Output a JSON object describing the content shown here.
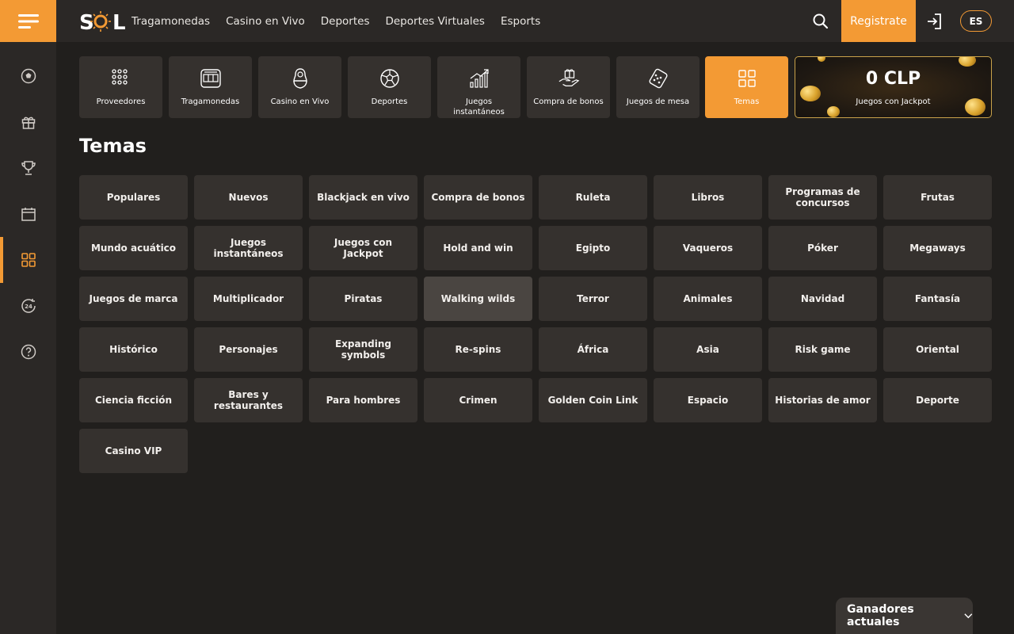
{
  "header": {
    "logo_text": "SOL",
    "nav": [
      "Tragamonedas",
      "Casino en Vivo",
      "Deportes",
      "Deportes Virtuales",
      "Esports"
    ],
    "register_label": "Registrate",
    "language": "ES",
    "accent_color": "#f39a34"
  },
  "sidebar": {
    "items": [
      "soccer-ball-icon",
      "gift-icon",
      "trophy-icon",
      "calendar-icon",
      "grid-icon",
      "support-24-icon",
      "help-icon"
    ],
    "active_index": 4
  },
  "categories": [
    {
      "label": "Proveedores",
      "icon": "dots-grid-icon"
    },
    {
      "label": "Tragamonedas",
      "icon": "slot-machine-icon"
    },
    {
      "label": "Casino en Vivo",
      "icon": "dealer-icon"
    },
    {
      "label": "Deportes",
      "icon": "soccer-ball-icon"
    },
    {
      "label": "Juegos instantáneos",
      "icon": "chart-up-icon"
    },
    {
      "label": "Compra de bonos",
      "icon": "hand-gift-icon"
    },
    {
      "label": "Juegos de mesa",
      "icon": "dice-icon"
    },
    {
      "label": "Temas",
      "icon": "grid-icon",
      "active": true
    }
  ],
  "jackpot": {
    "amount": "0 CLP",
    "label": "Juegos con Jackpot"
  },
  "page_title": "Temas",
  "themes": [
    "Populares",
    "Nuevos",
    "Blackjack en vivo",
    "Compra de bonos",
    "Ruleta",
    "Libros",
    "Programas de concursos",
    "Frutas",
    "Mundo acuático",
    "Juegos instantáneos",
    "Juegos con Jackpot",
    "Hold and win",
    "Egipto",
    "Vaqueros",
    "Póker",
    "Megaways",
    "Juegos de marca",
    "Multiplicador",
    "Piratas",
    "Walking wilds",
    "Terror",
    "Animales",
    "Navidad",
    "Fantasía",
    "Histórico",
    "Personajes",
    "Expanding symbols",
    "Re-spins",
    "África",
    "Asia",
    "Risk game",
    "Oriental",
    "Ciencia ficción",
    "Bares y restaurantes",
    "Para hombres",
    "Crimen",
    "Golden Coin Link",
    "Espacio",
    "Historias de amor",
    "Deporte",
    "Casino VIP"
  ],
  "hovered_theme": "Walking wilds",
  "winners_label": "Ganadores actuales"
}
